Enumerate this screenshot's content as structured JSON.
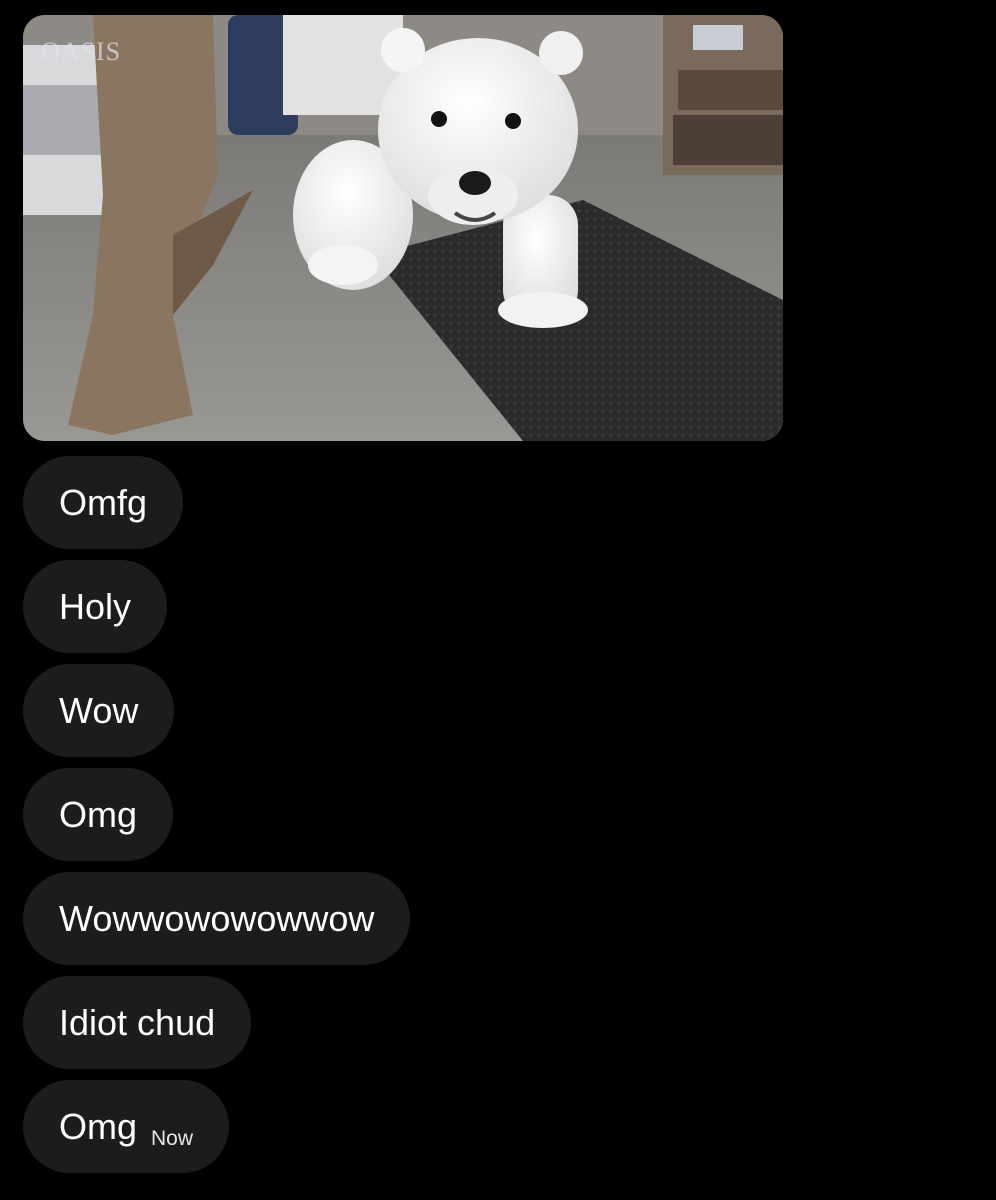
{
  "media": {
    "watermark_text": "OASIS"
  },
  "messages": [
    {
      "text": "Omfg"
    },
    {
      "text": "Holy"
    },
    {
      "text": "Wow"
    },
    {
      "text": "Omg"
    },
    {
      "text": "Wowwowowowwow"
    },
    {
      "text": "Idiot chud"
    },
    {
      "text": "Omg",
      "time": "Now"
    }
  ],
  "colors": {
    "background": "#000000",
    "bubble": "#1c1c1e",
    "text": "#ffffff"
  }
}
